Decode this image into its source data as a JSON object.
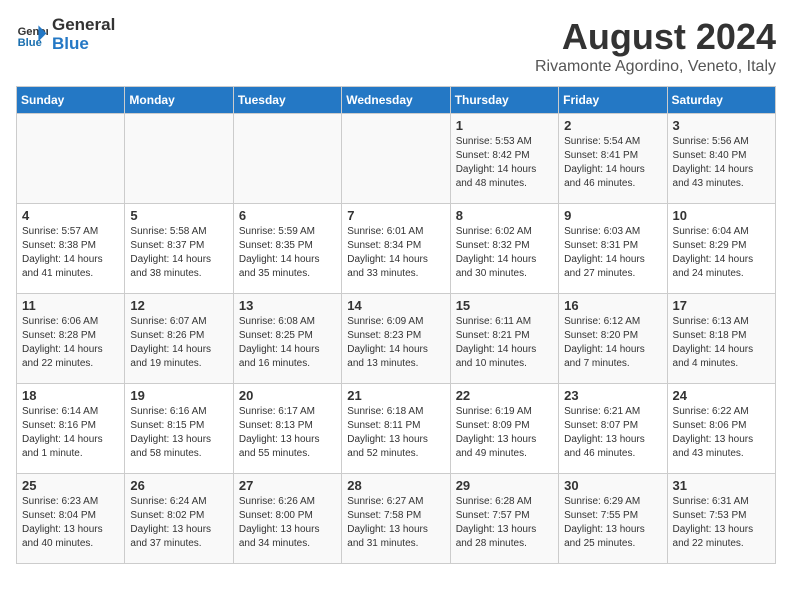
{
  "logo": {
    "text1": "General",
    "text2": "Blue"
  },
  "title": "August 2024",
  "subtitle": "Rivamonte Agordino, Veneto, Italy",
  "days_of_week": [
    "Sunday",
    "Monday",
    "Tuesday",
    "Wednesday",
    "Thursday",
    "Friday",
    "Saturday"
  ],
  "weeks": [
    [
      {
        "day": "",
        "text": ""
      },
      {
        "day": "",
        "text": ""
      },
      {
        "day": "",
        "text": ""
      },
      {
        "day": "",
        "text": ""
      },
      {
        "day": "1",
        "text": "Sunrise: 5:53 AM\nSunset: 8:42 PM\nDaylight: 14 hours and 48 minutes."
      },
      {
        "day": "2",
        "text": "Sunrise: 5:54 AM\nSunset: 8:41 PM\nDaylight: 14 hours and 46 minutes."
      },
      {
        "day": "3",
        "text": "Sunrise: 5:56 AM\nSunset: 8:40 PM\nDaylight: 14 hours and 43 minutes."
      }
    ],
    [
      {
        "day": "4",
        "text": "Sunrise: 5:57 AM\nSunset: 8:38 PM\nDaylight: 14 hours and 41 minutes."
      },
      {
        "day": "5",
        "text": "Sunrise: 5:58 AM\nSunset: 8:37 PM\nDaylight: 14 hours and 38 minutes."
      },
      {
        "day": "6",
        "text": "Sunrise: 5:59 AM\nSunset: 8:35 PM\nDaylight: 14 hours and 35 minutes."
      },
      {
        "day": "7",
        "text": "Sunrise: 6:01 AM\nSunset: 8:34 PM\nDaylight: 14 hours and 33 minutes."
      },
      {
        "day": "8",
        "text": "Sunrise: 6:02 AM\nSunset: 8:32 PM\nDaylight: 14 hours and 30 minutes."
      },
      {
        "day": "9",
        "text": "Sunrise: 6:03 AM\nSunset: 8:31 PM\nDaylight: 14 hours and 27 minutes."
      },
      {
        "day": "10",
        "text": "Sunrise: 6:04 AM\nSunset: 8:29 PM\nDaylight: 14 hours and 24 minutes."
      }
    ],
    [
      {
        "day": "11",
        "text": "Sunrise: 6:06 AM\nSunset: 8:28 PM\nDaylight: 14 hours and 22 minutes."
      },
      {
        "day": "12",
        "text": "Sunrise: 6:07 AM\nSunset: 8:26 PM\nDaylight: 14 hours and 19 minutes."
      },
      {
        "day": "13",
        "text": "Sunrise: 6:08 AM\nSunset: 8:25 PM\nDaylight: 14 hours and 16 minutes."
      },
      {
        "day": "14",
        "text": "Sunrise: 6:09 AM\nSunset: 8:23 PM\nDaylight: 14 hours and 13 minutes."
      },
      {
        "day": "15",
        "text": "Sunrise: 6:11 AM\nSunset: 8:21 PM\nDaylight: 14 hours and 10 minutes."
      },
      {
        "day": "16",
        "text": "Sunrise: 6:12 AM\nSunset: 8:20 PM\nDaylight: 14 hours and 7 minutes."
      },
      {
        "day": "17",
        "text": "Sunrise: 6:13 AM\nSunset: 8:18 PM\nDaylight: 14 hours and 4 minutes."
      }
    ],
    [
      {
        "day": "18",
        "text": "Sunrise: 6:14 AM\nSunset: 8:16 PM\nDaylight: 14 hours and 1 minute."
      },
      {
        "day": "19",
        "text": "Sunrise: 6:16 AM\nSunset: 8:15 PM\nDaylight: 13 hours and 58 minutes."
      },
      {
        "day": "20",
        "text": "Sunrise: 6:17 AM\nSunset: 8:13 PM\nDaylight: 13 hours and 55 minutes."
      },
      {
        "day": "21",
        "text": "Sunrise: 6:18 AM\nSunset: 8:11 PM\nDaylight: 13 hours and 52 minutes."
      },
      {
        "day": "22",
        "text": "Sunrise: 6:19 AM\nSunset: 8:09 PM\nDaylight: 13 hours and 49 minutes."
      },
      {
        "day": "23",
        "text": "Sunrise: 6:21 AM\nSunset: 8:07 PM\nDaylight: 13 hours and 46 minutes."
      },
      {
        "day": "24",
        "text": "Sunrise: 6:22 AM\nSunset: 8:06 PM\nDaylight: 13 hours and 43 minutes."
      }
    ],
    [
      {
        "day": "25",
        "text": "Sunrise: 6:23 AM\nSunset: 8:04 PM\nDaylight: 13 hours and 40 minutes."
      },
      {
        "day": "26",
        "text": "Sunrise: 6:24 AM\nSunset: 8:02 PM\nDaylight: 13 hours and 37 minutes."
      },
      {
        "day": "27",
        "text": "Sunrise: 6:26 AM\nSunset: 8:00 PM\nDaylight: 13 hours and 34 minutes."
      },
      {
        "day": "28",
        "text": "Sunrise: 6:27 AM\nSunset: 7:58 PM\nDaylight: 13 hours and 31 minutes."
      },
      {
        "day": "29",
        "text": "Sunrise: 6:28 AM\nSunset: 7:57 PM\nDaylight: 13 hours and 28 minutes."
      },
      {
        "day": "30",
        "text": "Sunrise: 6:29 AM\nSunset: 7:55 PM\nDaylight: 13 hours and 25 minutes."
      },
      {
        "day": "31",
        "text": "Sunrise: 6:31 AM\nSunset: 7:53 PM\nDaylight: 13 hours and 22 minutes."
      }
    ]
  ]
}
